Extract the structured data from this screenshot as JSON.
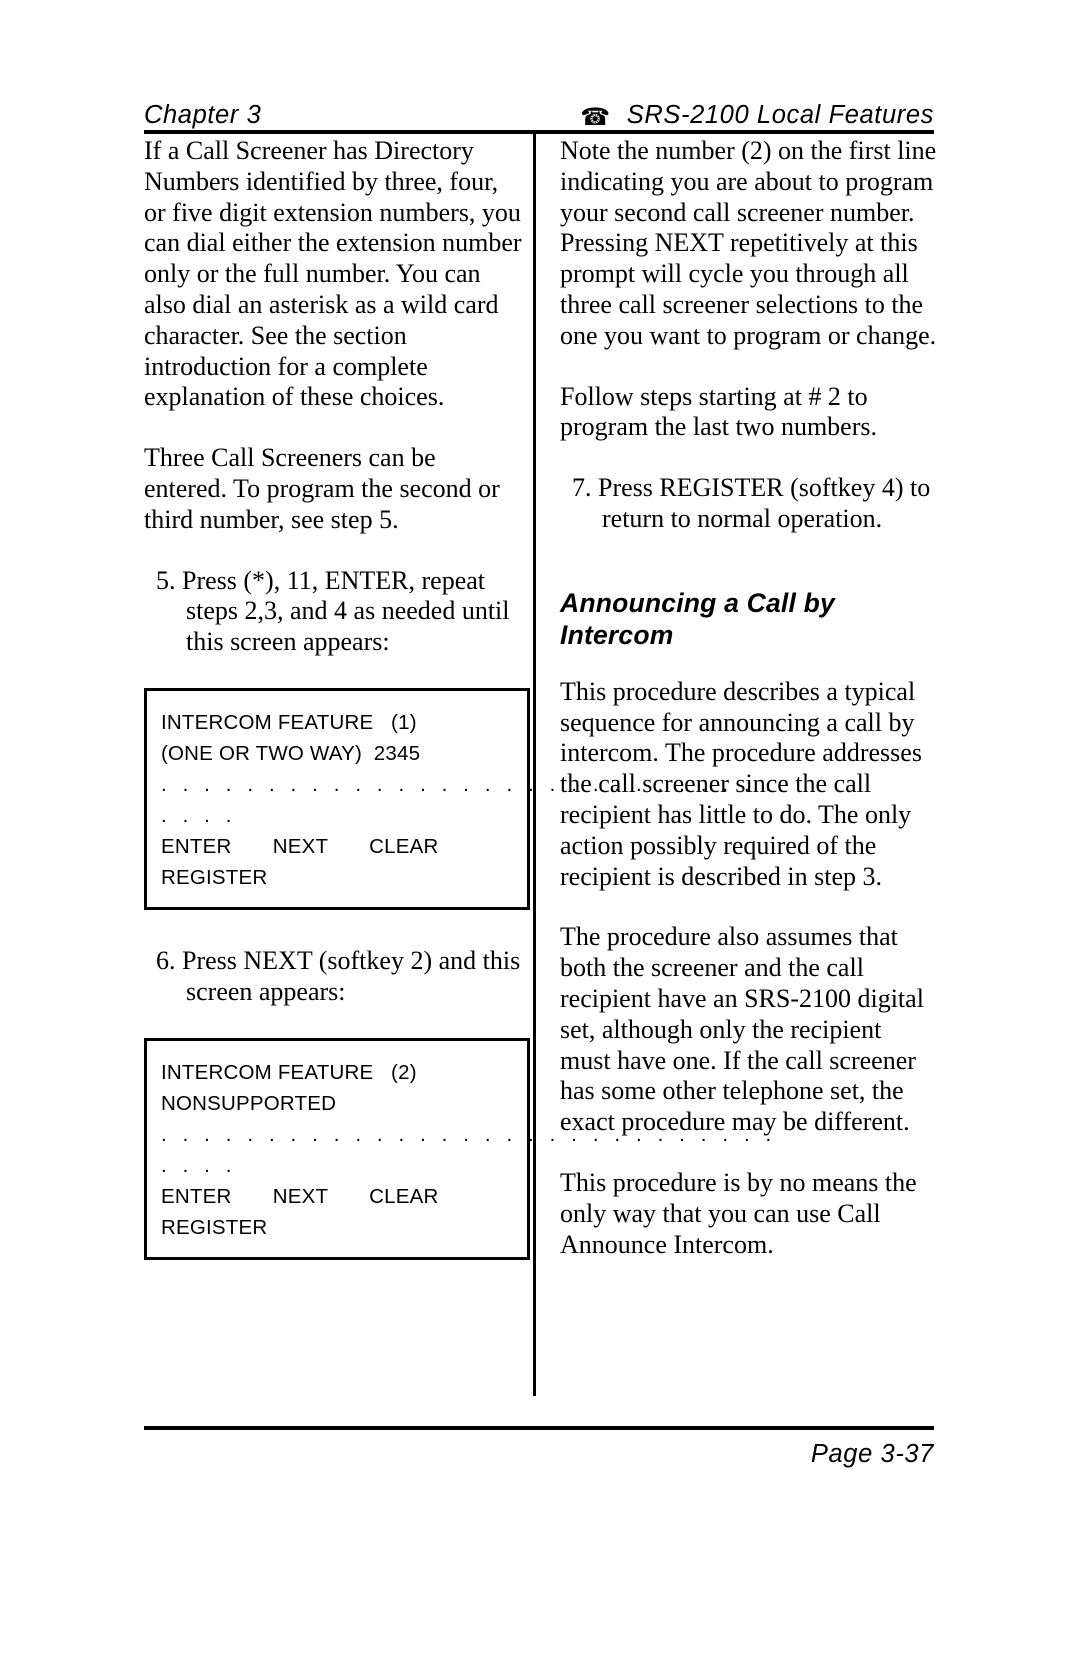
{
  "header": {
    "chapter": "Chapter 3",
    "phone_icon": "telephone-icon",
    "title": "SRS-2100 Local Features"
  },
  "left_column": {
    "paragraphs": [
      "If a Call Screener has Directory Numbers identified by three, four, or five digit extension numbers, you can dial either the extension number only or the full number. You can also dial an asterisk as a wild card character.  See the section introduction for a complete explanation of these choices.",
      "Three Call Screeners can be entered.  To program the second or third number, see step 5."
    ],
    "step5": "5. Press (*), 11, ENTER, repeat steps 2,3, and 4 as needed until this screen appears:",
    "step6": "6. Press NEXT (softkey 2) and this screen appears:",
    "lcd1": {
      "line1": "INTERCOM FEATURE   (1)",
      "line2": "(ONE OR TWO WAY)  2345",
      "line3": ". . . . . . . . . . . . . . . . . . . . . . . . . . . . .",
      "line4": ". . . .",
      "line5": "ENTER       NEXT       CLEAR",
      "line6": "REGISTER"
    },
    "lcd2": {
      "line1": "INTERCOM FEATURE   (2)",
      "line2": "NONSUPPORTED",
      "line3": ". . . . . . . . . . . . . . . . . . . . . . . . . . . . .",
      "line4": ". . . .",
      "line5": "ENTER       NEXT       CLEAR",
      "line6": "REGISTER"
    }
  },
  "right_column": {
    "paragraph1": "Note the number (2) on the first line indicating you are about to program your second call screener number.  Pressing NEXT repetitively at this prompt will cycle you through all three call screener selections to the one you want to program or change.",
    "paragraph2": "Follow steps starting at # 2 to program the last two numbers.",
    "step7": "7. Press REGISTER (softkey 4) to return to normal operation.",
    "section_heading": "Announcing a Call by Intercom",
    "paragraph3": "This procedure describes a typical sequence for announcing a call by intercom.  The procedure addresses the call screener since the call recipient has little to do.  The only action possibly required of the recipient is described in step 3.",
    "paragraph4": "The procedure also assumes that both the screener and the call recipient have an SRS-2100 digital set, although only the recipient must have one.  If the call screener has some other telephone set, the exact procedure may be different.",
    "paragraph5": "This procedure is by no means the only way that you can use Call Announce Intercom."
  },
  "footer": {
    "page_label": "Page 3-37"
  }
}
